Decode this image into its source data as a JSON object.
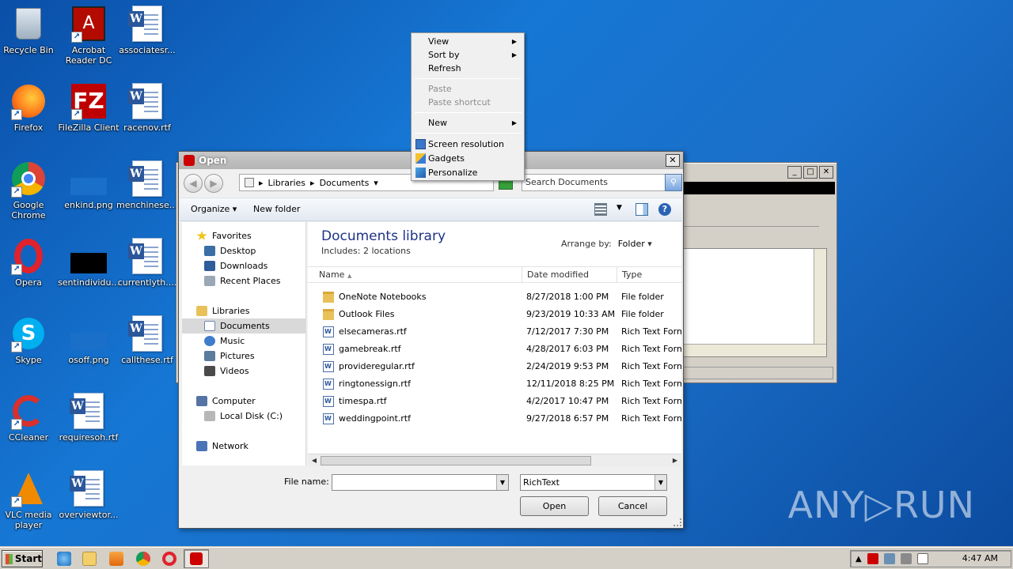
{
  "desktop": {
    "icons": [
      {
        "label": "Recycle Bin",
        "icon": "recycle-bin-icon"
      },
      {
        "label": "Acrobat Reader DC",
        "icon": "acrobat-icon"
      },
      {
        "label": "associatesr...",
        "icon": "word-doc-icon"
      },
      {
        "label": "Firefox",
        "icon": "firefox-icon"
      },
      {
        "label": "FileZilla Client",
        "icon": "filezilla-icon"
      },
      {
        "label": "racenov.rtf",
        "icon": "word-doc-icon"
      },
      {
        "label": "Google Chrome",
        "icon": "chrome-icon"
      },
      {
        "label": "enkind.png",
        "icon": "image-icon"
      },
      {
        "label": "menchinese....",
        "icon": "word-doc-icon"
      },
      {
        "label": "Opera",
        "icon": "opera-icon"
      },
      {
        "label": "sentindividu...",
        "icon": "image-icon"
      },
      {
        "label": "currentlyth....",
        "icon": "word-doc-icon"
      },
      {
        "label": "Skype",
        "icon": "skype-icon"
      },
      {
        "label": "osoff.png",
        "icon": "image-icon"
      },
      {
        "label": "callthese.rtf",
        "icon": "word-doc-icon"
      },
      {
        "label": "CCleaner",
        "icon": "ccleaner-icon"
      },
      {
        "label": "requiresoh.rtf",
        "icon": "word-doc-icon"
      },
      {
        "label": "VLC media player",
        "icon": "vlc-icon"
      },
      {
        "label": "overviewtor...",
        "icon": "word-doc-icon"
      }
    ],
    "watermark": "ANY▷RUN"
  },
  "context_menu": {
    "items": [
      {
        "label": "View",
        "submenu": true,
        "enabled": true
      },
      {
        "label": "Sort by",
        "submenu": true,
        "enabled": true
      },
      {
        "label": "Refresh",
        "submenu": false,
        "enabled": true
      },
      {
        "label": "Paste",
        "submenu": false,
        "enabled": false
      },
      {
        "label": "Paste shortcut",
        "submenu": false,
        "enabled": false
      },
      {
        "label": "New",
        "submenu": true,
        "enabled": true
      },
      {
        "label": "Screen resolution",
        "submenu": false,
        "enabled": true
      },
      {
        "label": "Gadgets",
        "submenu": false,
        "enabled": true
      },
      {
        "label": "Personalize",
        "submenu": false,
        "enabled": true
      }
    ]
  },
  "dialog": {
    "title": "Open",
    "close_label": "✕",
    "breadcrumb": [
      "Libraries",
      "Documents"
    ],
    "search_placeholder": "Search Documents",
    "toolbar": {
      "organize": "Organize",
      "new_folder": "New folder"
    },
    "nav": {
      "favorites": "Favorites",
      "desktop": "Desktop",
      "downloads": "Downloads",
      "recent": "Recent Places",
      "libraries": "Libraries",
      "documents": "Documents",
      "music": "Music",
      "pictures": "Pictures",
      "videos": "Videos",
      "computer": "Computer",
      "local_disk": "Local Disk (C:)",
      "network": "Network"
    },
    "library_title": "Documents library",
    "library_includes": "Includes:  2 locations",
    "arrange_by_label": "Arrange by:",
    "arrange_by_value": "Folder",
    "columns": {
      "name": "Name",
      "date": "Date modified",
      "type": "Type"
    },
    "files": [
      {
        "name": "OneNote Notebooks",
        "date": "8/27/2018 1:00 PM",
        "type": "File folder",
        "kind": "folder"
      },
      {
        "name": "Outlook Files",
        "date": "9/23/2019 10:33 AM",
        "type": "File folder",
        "kind": "folder"
      },
      {
        "name": "elsecameras.rtf",
        "date": "7/12/2017 7:30 PM",
        "type": "Rich Text Forma",
        "kind": "doc"
      },
      {
        "name": "gamebreak.rtf",
        "date": "4/28/2017 6:03 PM",
        "type": "Rich Text Forma",
        "kind": "doc"
      },
      {
        "name": "provideregular.rtf",
        "date": "2/24/2019 9:53 PM",
        "type": "Rich Text Forma",
        "kind": "doc"
      },
      {
        "name": "ringtonessign.rtf",
        "date": "12/11/2018 8:25 PM",
        "type": "Rich Text Forma",
        "kind": "doc"
      },
      {
        "name": "timespa.rtf",
        "date": "4/2/2017 10:47 PM",
        "type": "Rich Text Forma",
        "kind": "doc"
      },
      {
        "name": "weddingpoint.rtf",
        "date": "9/27/2018 6:57 PM",
        "type": "Rich Text Forma",
        "kind": "doc"
      }
    ],
    "file_name_label": "File name:",
    "file_name_value": "",
    "file_type_value": "RichText",
    "open_button": "Open",
    "cancel_button": "Cancel"
  },
  "taskbar": {
    "start_label": "Start",
    "clock": "4:47 AM"
  }
}
